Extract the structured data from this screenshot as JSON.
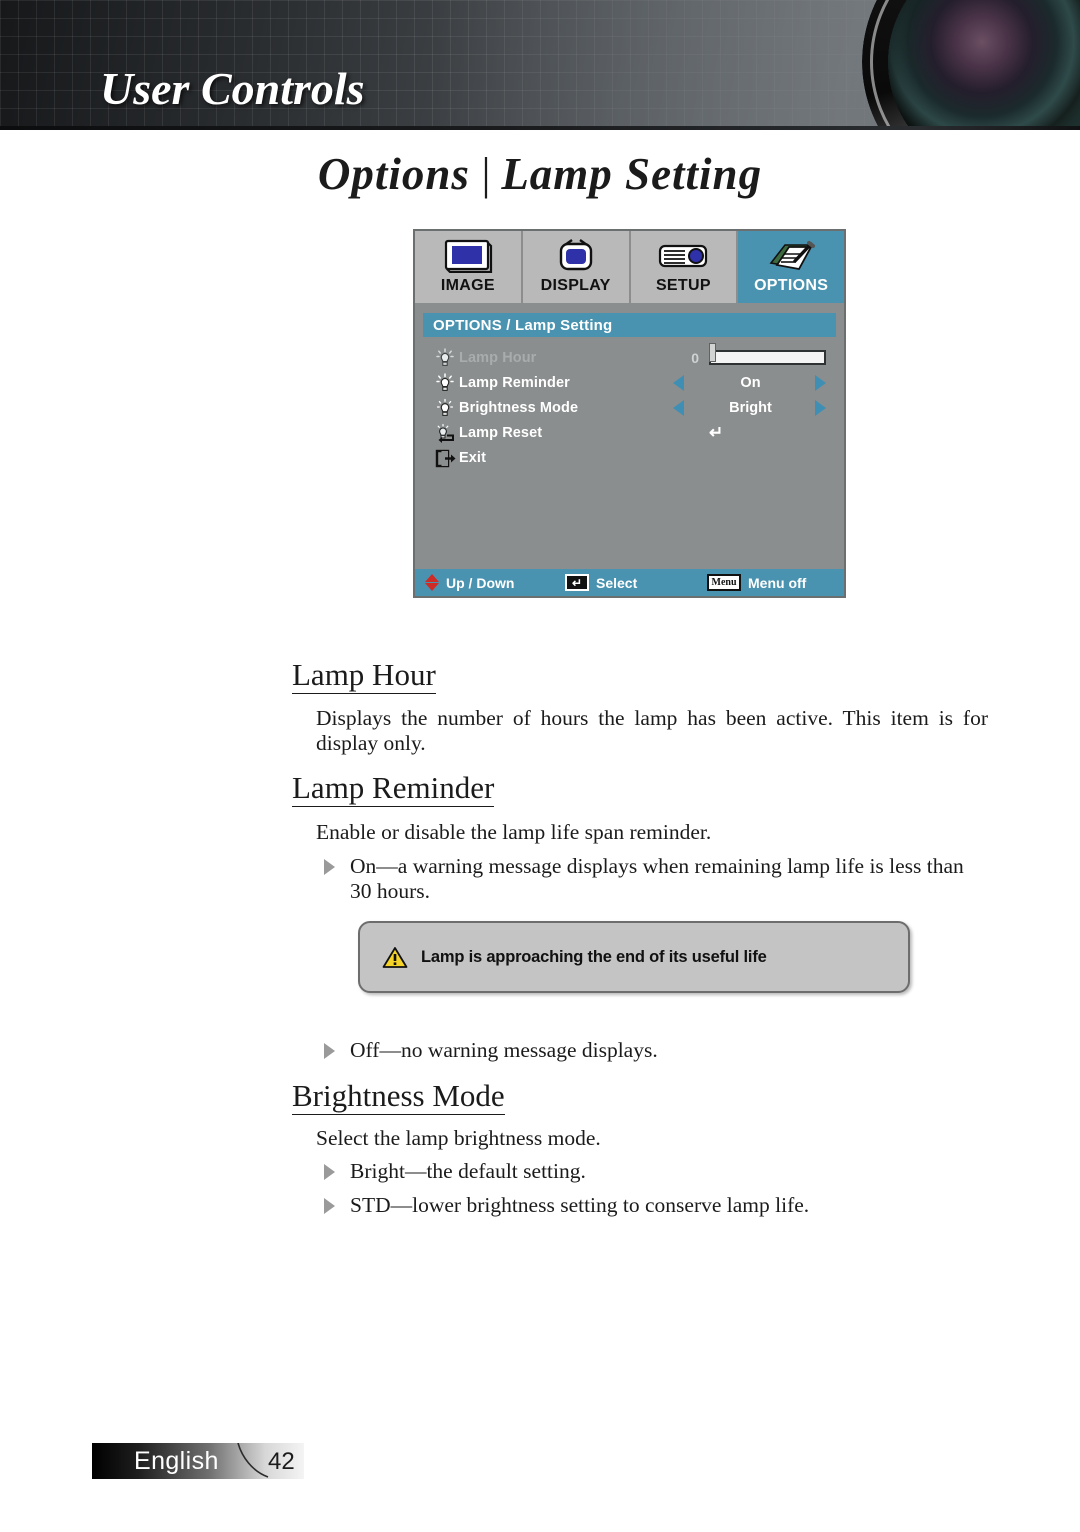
{
  "header": {
    "title": "User Controls",
    "lens_icon": "camera-lens-image"
  },
  "page_title": {
    "left": "Options",
    "separator": "|",
    "right": "Lamp Setting"
  },
  "osd": {
    "tabs": [
      {
        "label": "IMAGE",
        "icon": "monitor-icon",
        "active": false
      },
      {
        "label": "DISPLAY",
        "icon": "television-icon",
        "active": false
      },
      {
        "label": "SETUP",
        "icon": "projector-icon",
        "active": false
      },
      {
        "label": "OPTIONS",
        "icon": "document-pen-icon",
        "active": true
      }
    ],
    "heading": "OPTIONS / Lamp Setting",
    "rows": [
      {
        "label": "Lamp Hour",
        "icon": "lamp-rays-icon",
        "type": "slider",
        "value": "0",
        "disabled": true
      },
      {
        "label": "Lamp Reminder",
        "icon": "lamp-rays-icon",
        "type": "select",
        "value": "On"
      },
      {
        "label": "Brightness Mode",
        "icon": "lamp-bulb-icon",
        "type": "select",
        "value": "Bright"
      },
      {
        "label": "Lamp Reset",
        "icon": "lamp-reset-icon",
        "type": "enter",
        "value": "↵"
      },
      {
        "label": "Exit",
        "icon": "exit-door-icon",
        "type": "none",
        "value": ""
      }
    ],
    "status": [
      {
        "label": "Up / Down",
        "icon": "up-down-arrows-icon"
      },
      {
        "label": "Select",
        "icon": "enter-key-icon",
        "key": "↵"
      },
      {
        "label": "Menu off",
        "icon": "menu-key-icon",
        "key": "Menu"
      }
    ],
    "colors": {
      "accent": "#4a93b0",
      "body": "#8b8e8e",
      "tab": "#b9b9b9"
    }
  },
  "content": {
    "sections": [
      {
        "heading": "Lamp Hour",
        "paragraph": "Displays the number of hours the lamp has been active. This item is for display only."
      },
      {
        "heading": "Lamp Reminder",
        "paragraph": "Enable or disable the lamp life span reminder.",
        "bullet1": "On—a warning message displays when remaining lamp life is less than 30 hours.",
        "bullet2": "Off—no warning message displays."
      },
      {
        "heading": "Brightness Mode",
        "paragraph": "Select the lamp brightness mode.",
        "bullet1": "Bright—the default setting.",
        "bullet2": "STD—lower brightness setting to conserve lamp life."
      }
    ]
  },
  "warning_dialog": {
    "icon": "warning-triangle-icon",
    "message": "Lamp is approaching the end of its useful life"
  },
  "footer": {
    "language": "English",
    "page_number": "42"
  }
}
